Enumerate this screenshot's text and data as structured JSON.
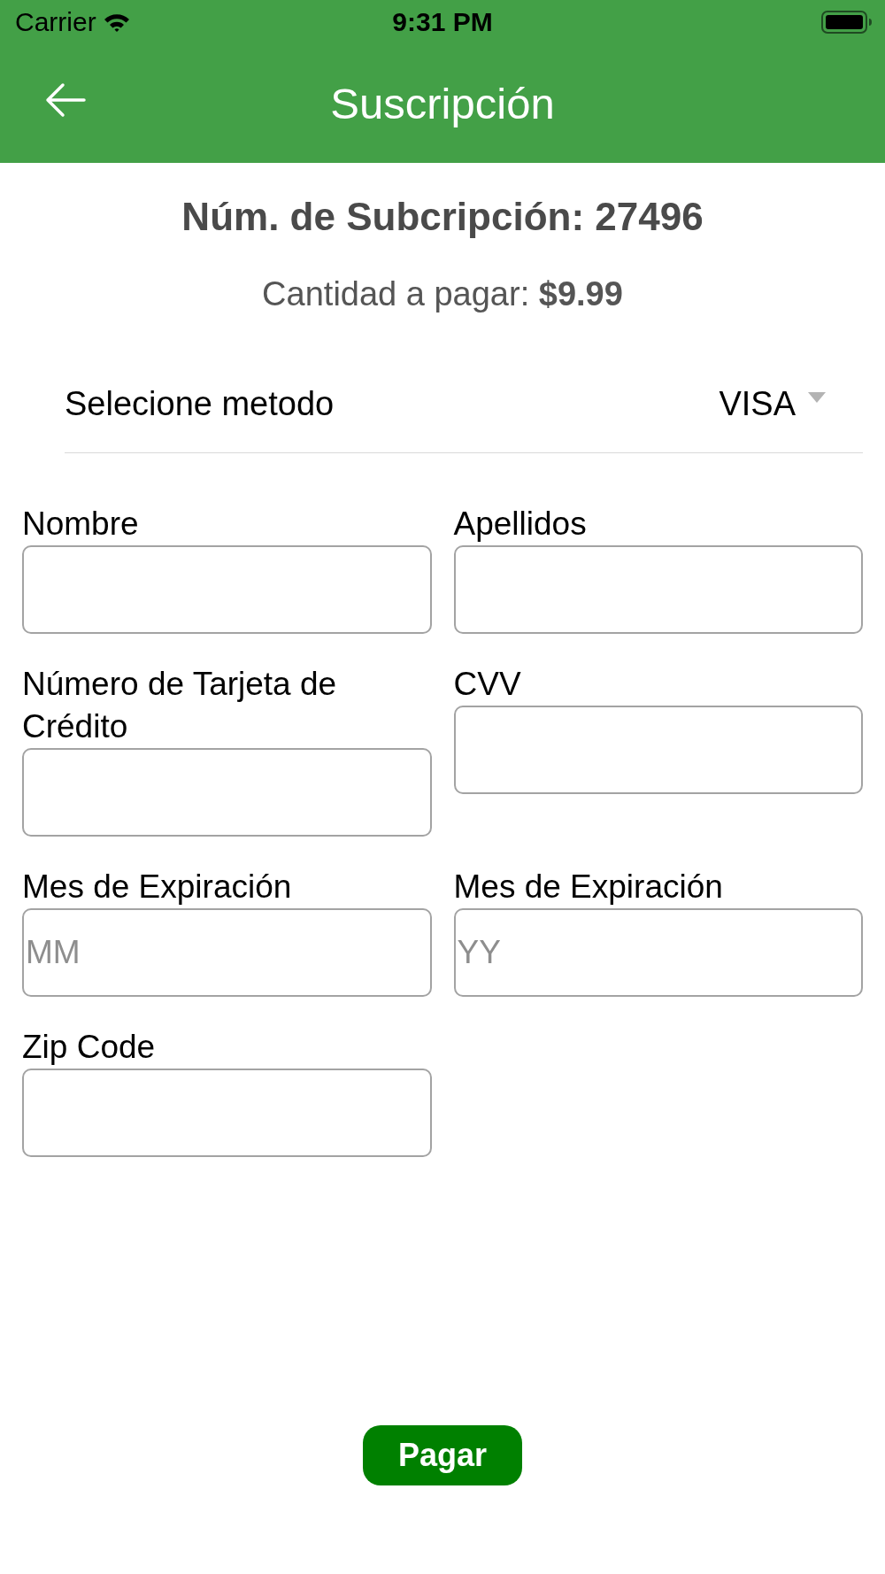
{
  "status_bar": {
    "carrier": "Carrier",
    "time": "9:31 PM"
  },
  "header": {
    "title": "Suscripción"
  },
  "subscription": {
    "number_line": "Núm. de Subcripción: 27496",
    "amount_line": "Cantidad a pagar: **$9.99**"
  },
  "payment_method": {
    "label": "Selecione metodo",
    "value": "VISA"
  },
  "fields": [
    {
      "label": "Nombre"
    },
    {
      "label": "Apellidos"
    },
    {
      "label": "Número de Tarjeta de Crédito"
    },
    {
      "label": "CVV"
    },
    {
      "label": "Mes de Expiración",
      "placeholder": "MM"
    },
    {
      "label": "Mes de Expiración",
      "placeholder": "YY"
    },
    {
      "label": "Zip Code"
    }
  ],
  "buttons": {
    "pay": "Pagar"
  }
}
